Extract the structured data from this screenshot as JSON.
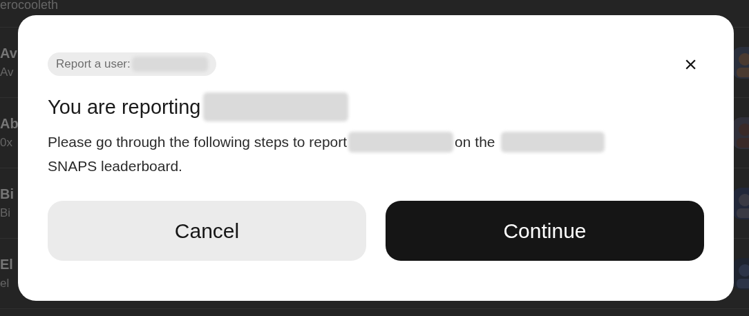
{
  "background_list": {
    "top_fragment": "erocooleth",
    "rows": [
      {
        "name": "Av",
        "subtitle": "Av"
      },
      {
        "name": "Ab",
        "subtitle": "0x"
      },
      {
        "name": "Bi",
        "subtitle": "Bi"
      },
      {
        "name": "El",
        "subtitle": "el"
      }
    ]
  },
  "dialog": {
    "chip": "Report a user:",
    "title": "You are reporting",
    "description_start": "Please go through the following steps to report",
    "description_middle": "on the",
    "description_end": "SNAPS leaderboard.",
    "close_label": "×",
    "buttons": [
      {
        "label": "Cancel",
        "kind": "secondary"
      },
      {
        "label": "Continue",
        "kind": "primary"
      }
    ]
  }
}
